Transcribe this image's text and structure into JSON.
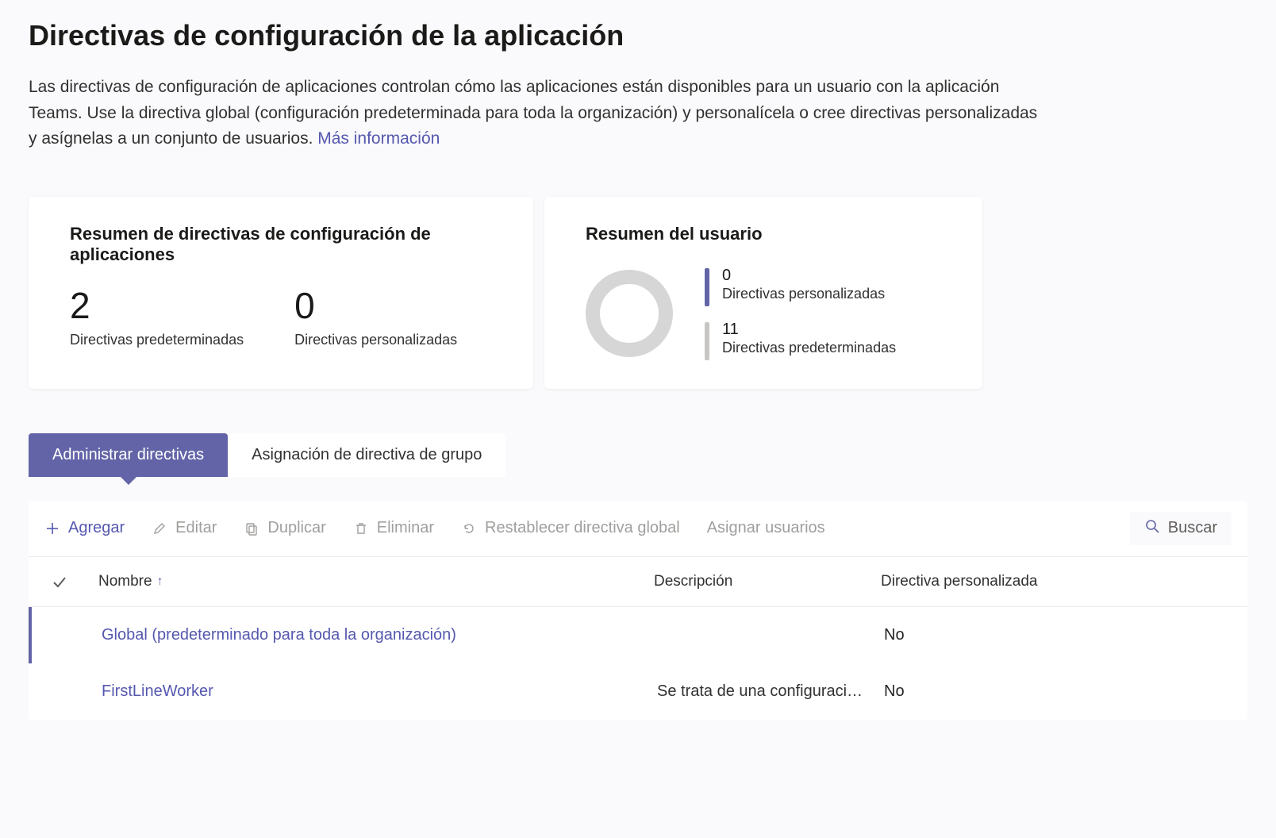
{
  "page": {
    "title": "Directivas de configuración de la aplicación",
    "description": "Las directivas de configuración de aplicaciones controlan cómo las aplicaciones están disponibles para un usuario con la aplicación Teams. Use la directiva global (configuración predeterminada para toda la organización) y personalícela o cree directivas personalizadas y asígnelas a un conjunto de usuarios. ",
    "learn_more": "Más información"
  },
  "summary_card": {
    "title": "Resumen de directivas de configuración de aplicaciones",
    "default_count": "2",
    "default_label": "Directivas predeterminadas",
    "custom_count": "0",
    "custom_label": "Directivas personalizadas"
  },
  "user_card": {
    "title": "Resumen del usuario",
    "custom_count": "0",
    "custom_label": "Directivas personalizadas",
    "default_count": "11",
    "default_label": "Directivas predeterminadas"
  },
  "tabs": {
    "manage": "Administrar directivas",
    "group": "Asignación de directiva de grupo"
  },
  "toolbar": {
    "add": "Agregar",
    "edit": "Editar",
    "duplicate": "Duplicar",
    "delete": "Eliminar",
    "reset": "Restablecer directiva global",
    "assign": "Asignar usuarios",
    "search": "Buscar"
  },
  "table": {
    "headers": {
      "name": "Nombre",
      "description": "Descripción",
      "custom": "Directiva personalizada"
    },
    "rows": [
      {
        "name": "Global (predeterminado para toda la organización)",
        "description": "",
        "custom": "No"
      },
      {
        "name": "FirstLineWorker",
        "description": "Se trata de una configuraci…",
        "custom": "No"
      }
    ]
  }
}
